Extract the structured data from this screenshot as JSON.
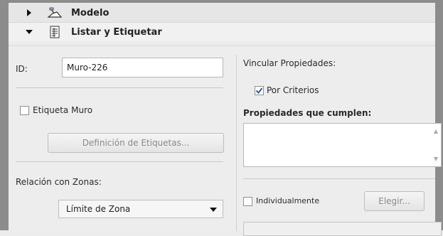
{
  "sections": {
    "model": {
      "label": "Modelo",
      "icon": "model-icon",
      "expanded": false
    },
    "list_label": {
      "label": "Listar y Etiquetar",
      "icon": "list-label-icon",
      "expanded": true
    }
  },
  "left": {
    "id_label": "ID:",
    "id_value": "Muro-226",
    "label_wall_checkbox": "Etiqueta Muro",
    "label_wall_checked": false,
    "label_definition_button": "Definición de Etiquetas...",
    "zone_relation_label": "Relación con Zonas:",
    "zone_relation_value": "Límite de Zona"
  },
  "right": {
    "link_properties_label": "Vincular Propiedades:",
    "by_criteria_label": "Por Criterios",
    "by_criteria_checked": true,
    "matching_properties_label": "Propiedades que cumplen:",
    "individually_label": "Individualmente",
    "individually_checked": false,
    "choose_button": "Elegir..."
  }
}
